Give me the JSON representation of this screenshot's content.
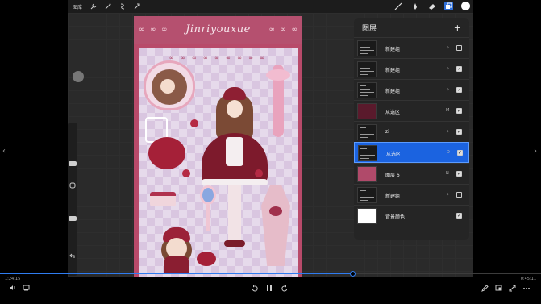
{
  "toolbar": {
    "gallery_label": "图库",
    "left_tools": [
      "wrench-icon",
      "magic-wand-icon",
      "selection-icon",
      "transform-icon"
    ],
    "right_tools": [
      "brush-icon",
      "smudge-icon",
      "eraser-icon",
      "layers-icon",
      "color-icon"
    ],
    "active_tool": "layers-icon",
    "current_color": "#ffffff"
  },
  "sidebar": {
    "brush_size_level": 0.22,
    "opacity_level": 0.78,
    "modify_icon": "square-icon",
    "undo_icon": "undo-icon"
  },
  "artwork": {
    "title": "Jinriyouxue",
    "pretzels": "ღ ღ ღ ღ ღ ღ ღ"
  },
  "layers_panel": {
    "title": "图层",
    "add_icon": "plus-icon",
    "layers": [
      {
        "name": "新建组",
        "blend": "",
        "chevron": true,
        "checked": false,
        "selected": false
      },
      {
        "name": "新建组",
        "blend": "",
        "chevron": true,
        "checked": true,
        "selected": false
      },
      {
        "name": "新建组",
        "blend": "",
        "chevron": true,
        "checked": true,
        "selected": false
      },
      {
        "name": "从选区",
        "blend": "M",
        "chevron": false,
        "checked": true,
        "selected": false
      },
      {
        "name": "zi",
        "blend": "",
        "chevron": true,
        "checked": true,
        "selected": false
      },
      {
        "name": "从选区",
        "blend": "D",
        "chevron": false,
        "checked": true,
        "selected": true
      },
      {
        "name": "图层 6",
        "blend": "N",
        "chevron": false,
        "checked": true,
        "selected": false
      },
      {
        "name": "新建组",
        "blend": "",
        "chevron": true,
        "checked": false,
        "selected": false
      },
      {
        "name": "背景颜色",
        "blend": "",
        "chevron": false,
        "checked": true,
        "selected": false
      }
    ]
  },
  "video": {
    "elapsed": "1:24:15",
    "remaining": "0:45:11",
    "progress": 0.652,
    "left_icons": [
      "volume-icon",
      "subtitle-icon"
    ],
    "center_icons": [
      "rewind-icon",
      "pause-icon",
      "forward-icon"
    ],
    "right_icons": [
      "edit-icon",
      "screen-icon",
      "fullscreen-icon",
      "more-icon"
    ]
  },
  "nav": {
    "prev": "‹",
    "next": "›"
  }
}
